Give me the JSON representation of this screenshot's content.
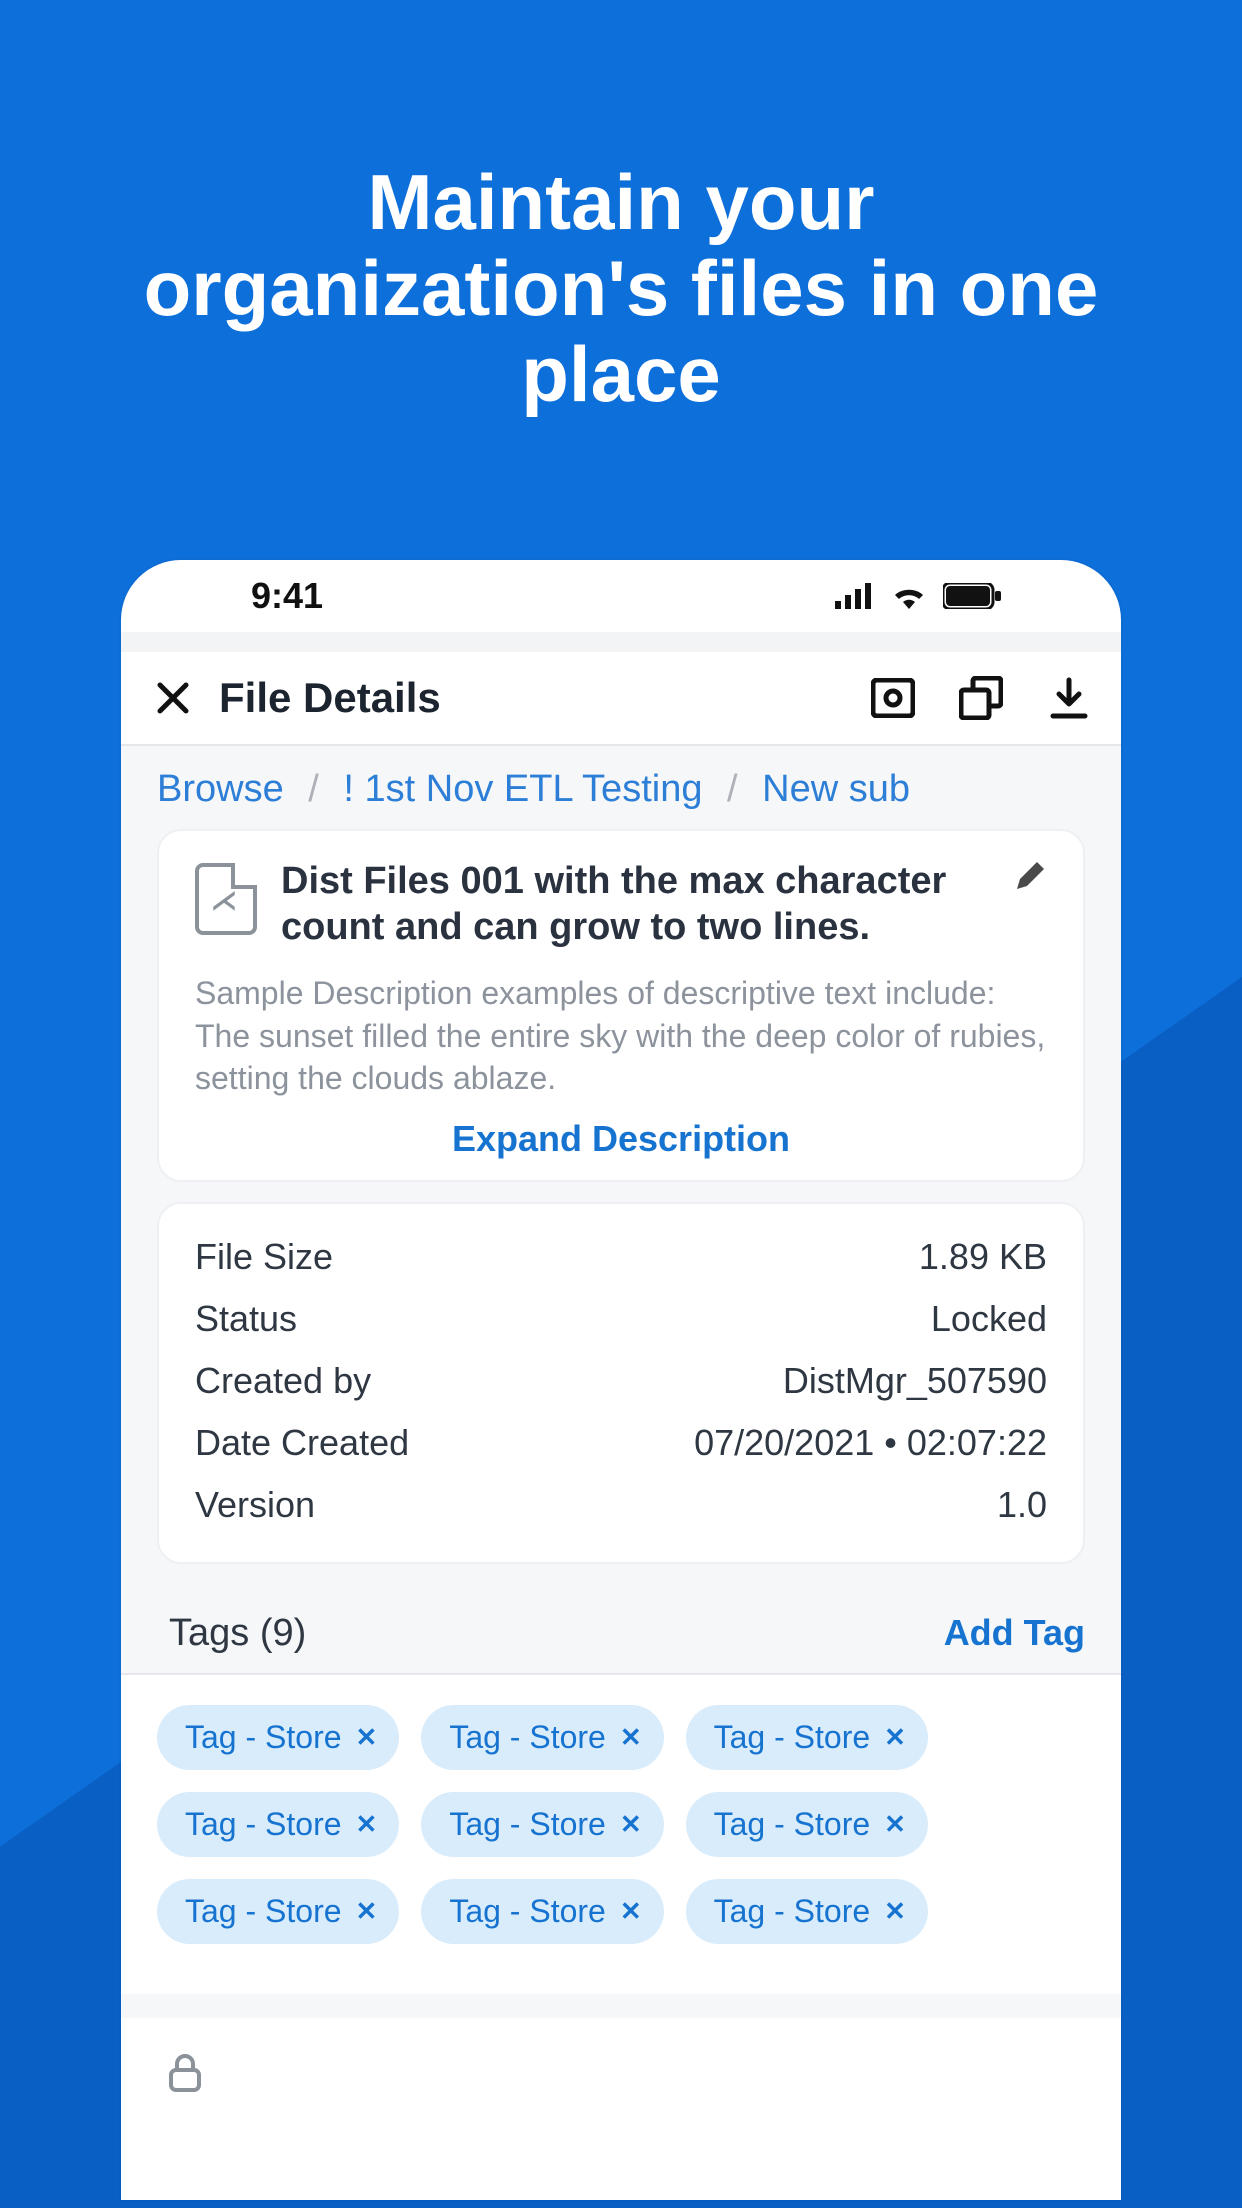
{
  "promo": {
    "heading": "Maintain your organization's files in one place"
  },
  "statusBar": {
    "time": "9:41"
  },
  "header": {
    "title": "File Details"
  },
  "breadcrumb": {
    "items": [
      "Browse",
      "! 1st Nov ETL Testing",
      "New sub"
    ]
  },
  "file": {
    "name": "Dist Files 001 with the max character count and can grow to two lines.",
    "description": "Sample Description examples of descriptive text include: The sunset filled the entire sky with the deep color of rubies, setting the clouds ablaze.",
    "expand_label": "Expand Description"
  },
  "meta": {
    "rows": [
      {
        "k": "File Size",
        "v": "1.89 KB"
      },
      {
        "k": "Status",
        "v": "Locked"
      },
      {
        "k": "Created by",
        "v": "DistMgr_507590"
      },
      {
        "k": "Date Created",
        "v": "07/20/2021 • 02:07:22"
      },
      {
        "k": "Version",
        "v": "1.0"
      }
    ]
  },
  "tags": {
    "header": "Tags (9)",
    "add_label": "Add Tag",
    "items": [
      "Tag - Store",
      "Tag - Store",
      "Tag - Store",
      "Tag - Store",
      "Tag - Store",
      "Tag - Store",
      "Tag - Store",
      "Tag - Store",
      "Tag - Store"
    ]
  }
}
